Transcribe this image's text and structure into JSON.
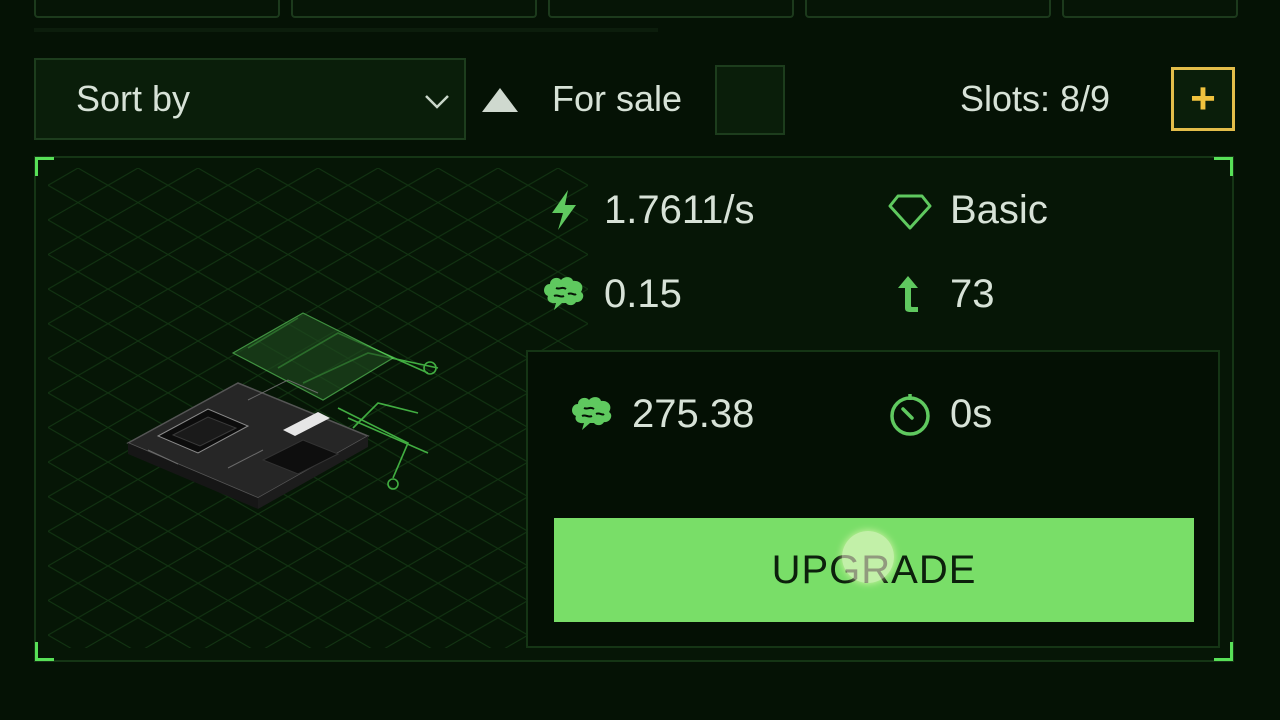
{
  "toolbar": {
    "sort_label": "Sort by",
    "sort_direction_icon": "triangle-up-icon",
    "for_sale_label": "For sale",
    "for_sale_checked": false,
    "slots_text": "Slots: 8/9",
    "add_slot_symbol": "+"
  },
  "card": {
    "stats": {
      "rate": "1.7611/s",
      "tier": "Basic",
      "brain_value": "0.15",
      "level": "73"
    },
    "upgrade": {
      "cost": "275.38",
      "time": "0s",
      "button_label": "UPGRADE"
    }
  },
  "colors": {
    "background": "#051205",
    "accent_green": "#79de68",
    "icon_green": "#5fc95f",
    "gold": "#e3bd4a"
  }
}
